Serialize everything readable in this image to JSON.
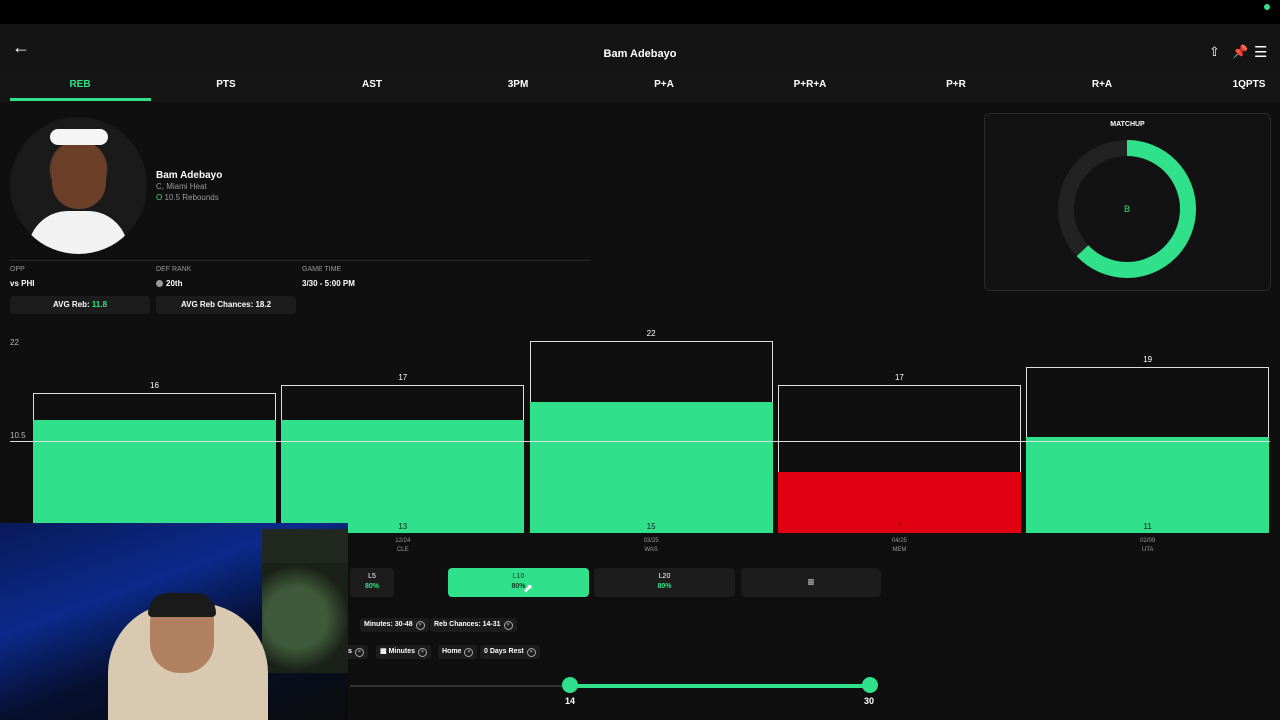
{
  "header": {
    "title": "Bam Adebayo",
    "back_icon": "arrow-left-icon",
    "icons": [
      "share-icon",
      "pin-icon",
      "menu-icon"
    ]
  },
  "tabs": [
    {
      "label": "REB",
      "active": true
    },
    {
      "label": "PTS"
    },
    {
      "label": "AST"
    },
    {
      "label": "3PM"
    },
    {
      "label": "P+A"
    },
    {
      "label": "P+R+A"
    },
    {
      "label": "P+R"
    },
    {
      "label": "R+A"
    },
    {
      "label": "1QPTS"
    }
  ],
  "player": {
    "name": "Bam Adebayo",
    "team": "C, Miami Heat",
    "line_marker": "O",
    "line": "10.5 Rebounds"
  },
  "meta": {
    "opp_label": "OPP",
    "opp_value": "vs PHI",
    "def_label": "DEF RANK",
    "def_value": "20th",
    "time_label": "GAME TIME",
    "time_value": "3/30 - 5:00 PM"
  },
  "pills": {
    "avg_reb_label": "AVG Reb:",
    "avg_reb_value": "11.8",
    "avg_chances": "AVG Reb Chances: 18.2"
  },
  "matchup": {
    "title": "MATCHUP",
    "grade": "B",
    "fill_fraction": 0.63
  },
  "colors": {
    "accent": "#30e08a",
    "miss": "#e00012",
    "bg": "#0f0f0f"
  },
  "chart_data": {
    "type": "bar",
    "y_tick": "22",
    "line_label": "10.5",
    "line_value": 10.5,
    "ymax": 22,
    "bars": [
      {
        "top": "16",
        "top_value": 16,
        "value": 13,
        "bottom": "",
        "date": "",
        "opp": "",
        "hit": true
      },
      {
        "top": "17",
        "top_value": 17,
        "value": 13,
        "bottom": "13",
        "date": "12/24",
        "opp": "CLE",
        "hit": true
      },
      {
        "top": "22",
        "top_value": 22,
        "value": 15,
        "bottom": "15",
        "date": "03/25",
        "opp": "WAS",
        "hit": true
      },
      {
        "top": "17",
        "top_value": 17,
        "value": 7,
        "bottom": "7",
        "date": "04/25",
        "opp": "MEM",
        "hit": false
      },
      {
        "top": "19",
        "top_value": 19,
        "value": 11,
        "bottom": "11",
        "date": "02/09",
        "opp": "UTA",
        "hit": true
      }
    ]
  },
  "filters": [
    {
      "label": "L5",
      "pct": "80%",
      "active": false
    },
    {
      "label": "L10",
      "pct": "80%",
      "active": true
    },
    {
      "label": "L20",
      "pct": "80%",
      "active": false
    }
  ],
  "settings_icon": "sliders-icon",
  "chips_row1": [
    "Minutes: 30-48",
    "Reb Chances: 14-31"
  ],
  "chips_row2": [
    "s",
    "Minutes",
    "Home",
    "0 Days Rest"
  ],
  "slider": {
    "min": "14",
    "max": "30"
  }
}
